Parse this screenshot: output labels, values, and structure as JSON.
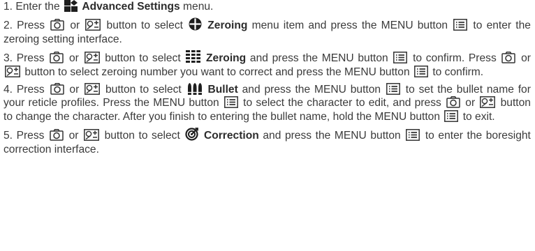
{
  "steps": [
    {
      "number": "1.",
      "parts": [
        "Enter the",
        "Advanced Settings",
        "menu."
      ]
    },
    {
      "number": "2.",
      "parts": [
        "Press",
        "or",
        "button to select",
        "Zeroing",
        "menu item and press the MENU button",
        "to enter the zeroing setting interface."
      ]
    },
    {
      "number": "3.",
      "parts": [
        "Press",
        "or",
        "button to select",
        "Zeroing",
        "and press the MENU button",
        "to confirm. Press",
        "or",
        "button to select zeroing number you want to correct and press the MENU button",
        "to confirm."
      ]
    },
    {
      "number": "4.",
      "parts": [
        "Press",
        "or",
        "button to select",
        "Bullet",
        "and press the MENU button",
        "to set the bullet name for your reticle profiles. Press the MENU button",
        "to select the character to edit, and press",
        "or",
        "button to change the character. After you finish to entering the bullet name, hold the MENU button",
        "to exit."
      ]
    },
    {
      "number": "5.",
      "parts": [
        "Press",
        "or",
        "button to select",
        "Correction",
        "and press the MENU button",
        "to enter the boresight correction interface."
      ]
    }
  ]
}
